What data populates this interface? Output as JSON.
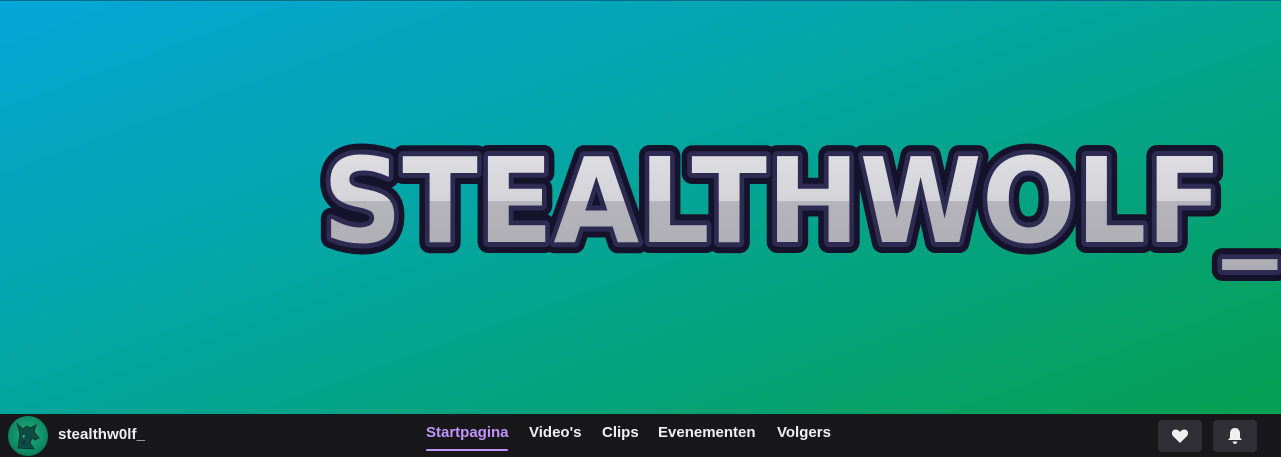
{
  "banner": {
    "logo_text": "STEALTHWOLF_",
    "colors": {
      "gradient_start": "#04a6d8",
      "gradient_end": "#06a052"
    }
  },
  "channel": {
    "name": "stealthw0lf_",
    "avatar_icon": "wolf-icon"
  },
  "tabs": [
    {
      "label": "Startpagina",
      "active": true
    },
    {
      "label": "Video's",
      "active": false
    },
    {
      "label": "Clips",
      "active": false
    },
    {
      "label": "Evenementen",
      "active": false
    },
    {
      "label": "Volgers",
      "active": false
    }
  ],
  "actions": {
    "follow_icon": "heart-icon",
    "notify_icon": "bell-icon"
  },
  "colors": {
    "accent": "#bf94ff",
    "bar_background": "#18181b",
    "button_background": "#2f2f35",
    "text": "#efeff1"
  }
}
